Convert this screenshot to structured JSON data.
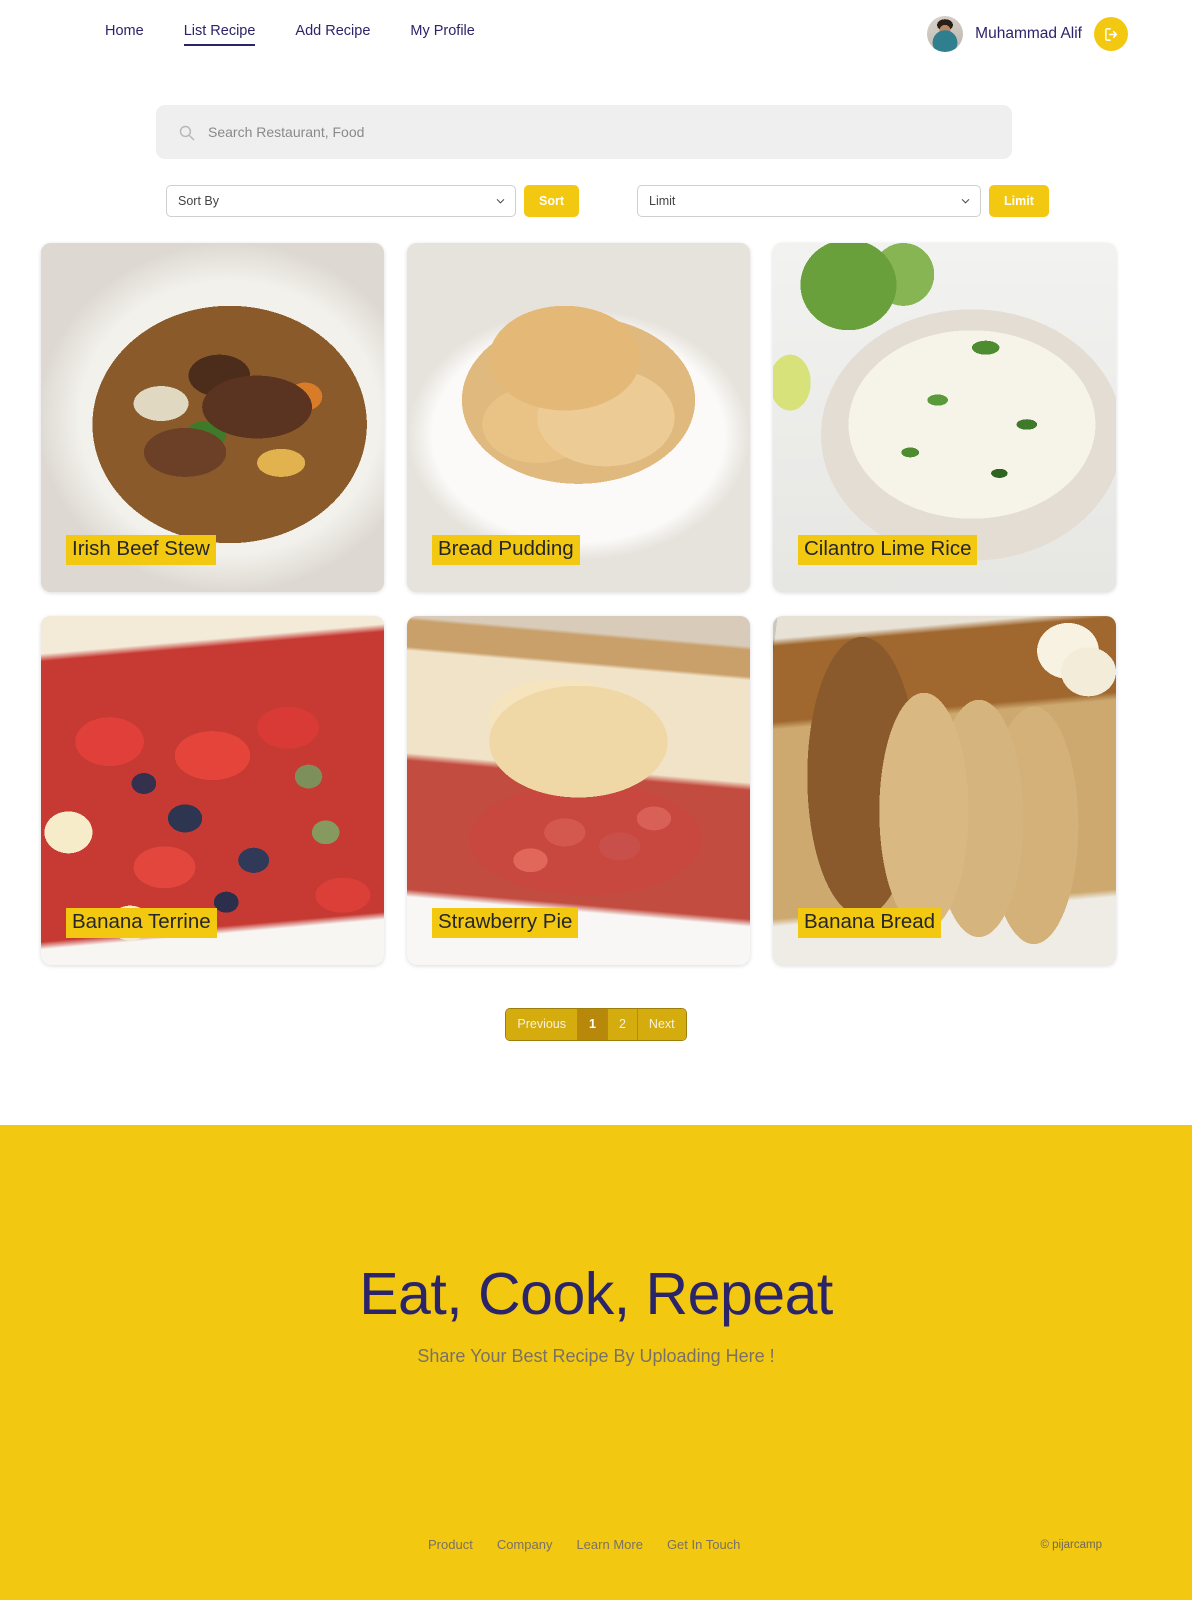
{
  "navbar": {
    "links": [
      {
        "label": "Home",
        "active": false
      },
      {
        "label": "List Recipe",
        "active": true
      },
      {
        "label": "Add Recipe",
        "active": false
      },
      {
        "label": "My Profile",
        "active": false
      }
    ],
    "user_name": "Muhammad Alif",
    "logout_icon": "logout-icon"
  },
  "search": {
    "placeholder": "Search Restaurant, Food",
    "value": "",
    "icon": "search-icon"
  },
  "filters": {
    "sort_select_value": "Sort By",
    "sort_button_label": "Sort",
    "limit_select_value": "Limit",
    "limit_button_label": "Limit"
  },
  "recipes": [
    {
      "title": "Irish Beef Stew"
    },
    {
      "title": "Bread Pudding"
    },
    {
      "title": "Cilantro Lime Rice"
    },
    {
      "title": "Banana Terrine"
    },
    {
      "title": "Strawberry Pie"
    },
    {
      "title": "Banana Bread"
    }
  ],
  "pagination": {
    "previous_label": "Previous",
    "pages": [
      {
        "label": "1",
        "active": true
      },
      {
        "label": "2",
        "active": false
      }
    ],
    "next_label": "Next"
  },
  "hero": {
    "title": "Eat, Cook, Repeat",
    "subtitle": "Share Your Best Recipe By Uploading Here !"
  },
  "footer": {
    "links": [
      "Product",
      "Company",
      "Learn More",
      "Get In Touch"
    ],
    "copyright": "© pijarcamp"
  },
  "colors": {
    "accent_yellow": "#f2c811",
    "navy": "#2b2469",
    "pagination": "#d4ac0d",
    "pagination_active": "#b8880a"
  }
}
